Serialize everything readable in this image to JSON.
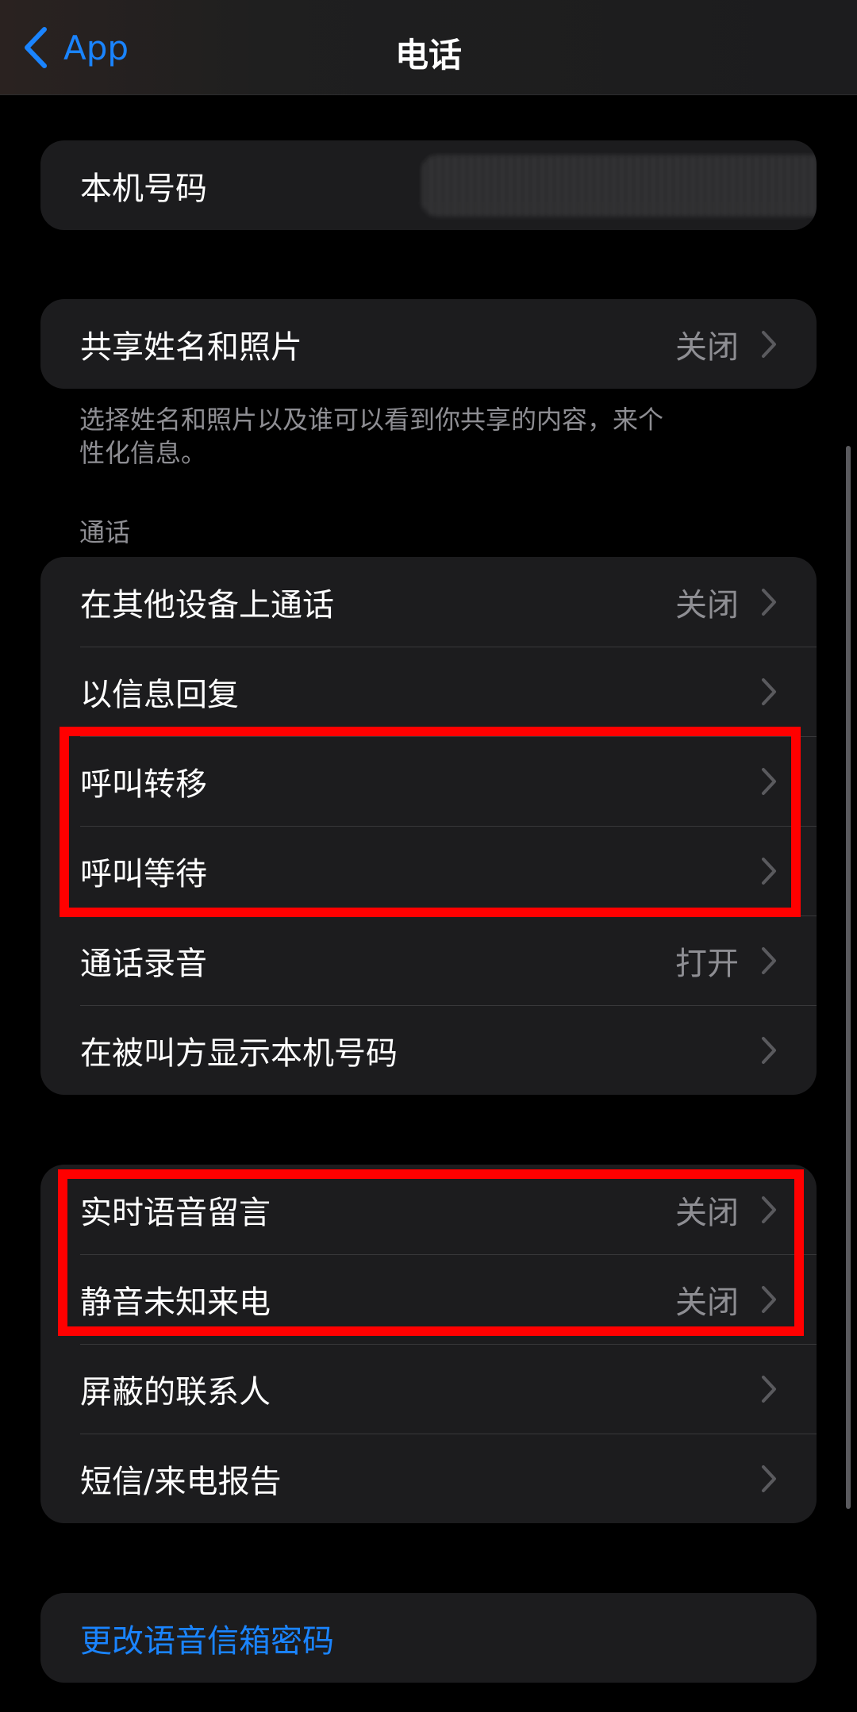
{
  "nav": {
    "back_label": "App",
    "title": "电话"
  },
  "number_group": {
    "label": "本机号码"
  },
  "share_group": {
    "label": "共享姓名和照片",
    "value": "关闭",
    "footnote": "选择姓名和照片以及谁可以看到你共享的内容，来个性化信息。"
  },
  "calls_section": {
    "header": "通话",
    "items": [
      {
        "label": "在其他设备上通话",
        "value": "关闭"
      },
      {
        "label": "以信息回复",
        "value": ""
      },
      {
        "label": "呼叫转移",
        "value": ""
      },
      {
        "label": "呼叫等待",
        "value": ""
      },
      {
        "label": "通话录音",
        "value": "打开"
      },
      {
        "label": "在被叫方显示本机号码",
        "value": ""
      }
    ]
  },
  "voicemail_group": {
    "items": [
      {
        "label": "实时语音留言",
        "value": "关闭"
      },
      {
        "label": "静音未知来电",
        "value": "关闭"
      },
      {
        "label": "屏蔽的联系人",
        "value": ""
      },
      {
        "label": "短信/来电报告",
        "value": ""
      }
    ]
  },
  "password_group": {
    "label": "更改语音信箱密码"
  },
  "colors": {
    "accent": "#1a84ff",
    "highlight": "#ff0000",
    "cell_bg": "#1c1c1e",
    "secondary_text": "#8e8e93"
  }
}
